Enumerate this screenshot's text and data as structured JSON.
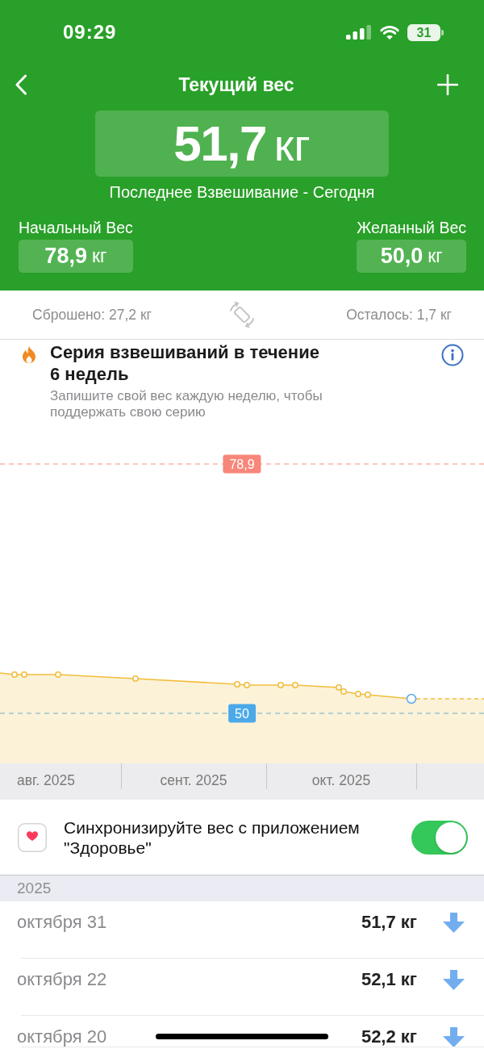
{
  "status_bar": {
    "time": "09:29",
    "battery": "31"
  },
  "header": {
    "title": "Текущий вес",
    "current_weight": {
      "value": "51,7",
      "unit": "кг"
    },
    "last_weighing": "Последнее Взвешивание - Сегодня",
    "start_weight": {
      "label": "Начальный Вес",
      "value": "78,9",
      "unit": "кг"
    },
    "goal_weight": {
      "label": "Желанный Вес",
      "value": "50,0",
      "unit": "кг"
    }
  },
  "summary": {
    "lost": "Сброшено: 27,2 кг",
    "remaining": "Осталось: 1,7 кг"
  },
  "streak": {
    "title": "Серия взвешиваний в течение 6 недель",
    "description": "Запишите свой вес каждую неделю, чтобы поддержать свою серию"
  },
  "chart": {
    "reference_labels": [
      {
        "label": "78,9",
        "color": "#f7877a"
      },
      {
        "label": "50",
        "color": "#4ba9ea"
      }
    ],
    "months": [
      "авг. 2025",
      "сент. 2025",
      "окт. 2025"
    ]
  },
  "sync": {
    "label": "Синхронизируйте вес с приложением \"Здоровье\"",
    "on": true
  },
  "history": {
    "year": "2025",
    "rows": [
      {
        "date": "октября 31",
        "weight": "51,7 кг",
        "decrease": true
      },
      {
        "date": "октября 22",
        "weight": "52,1 кг",
        "decrease": true
      },
      {
        "date": "октября 20",
        "weight": "52,2 кг",
        "decrease": true
      }
    ]
  }
}
